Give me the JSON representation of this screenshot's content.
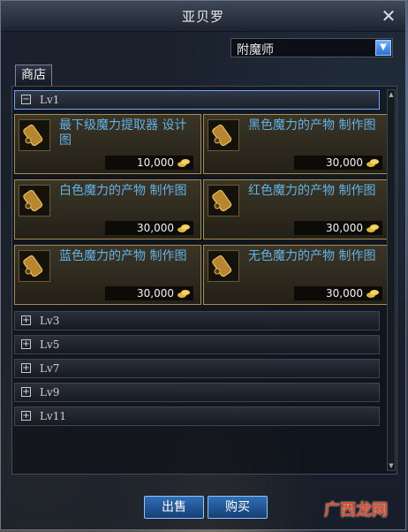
{
  "window": {
    "title": "亚贝罗"
  },
  "npc_select": {
    "value": "附魔师"
  },
  "tabs": [
    {
      "label": "商店"
    }
  ],
  "groups": {
    "lv1": {
      "label": "Lv1",
      "toggle": "−"
    },
    "collapsed": [
      {
        "label": "Lv3",
        "toggle": "+"
      },
      {
        "label": "Lv5",
        "toggle": "+"
      },
      {
        "label": "Lv7",
        "toggle": "+"
      },
      {
        "label": "Lv9",
        "toggle": "+"
      },
      {
        "label": "Lv11",
        "toggle": "+"
      }
    ]
  },
  "items": [
    {
      "name": "最下级魔力提取器 设计图",
      "price": "10,000"
    },
    {
      "name": "黑色魔力的产物 制作图",
      "price": "30,000"
    },
    {
      "name": "白色魔力的产物 制作图",
      "price": "30,000"
    },
    {
      "name": "红色魔力的产物 制作图",
      "price": "30,000"
    },
    {
      "name": "蓝色魔力的产物 制作图",
      "price": "30,000"
    },
    {
      "name": "无色魔力的产物 制作图",
      "price": "30,000"
    }
  ],
  "buttons": {
    "sell": "出售",
    "buy": "购买"
  },
  "watermark": "广西龙网",
  "colors": {
    "item_name": "#63b2e6",
    "accent_border": "#6ea6ff",
    "item_border": "#a58d4c"
  }
}
